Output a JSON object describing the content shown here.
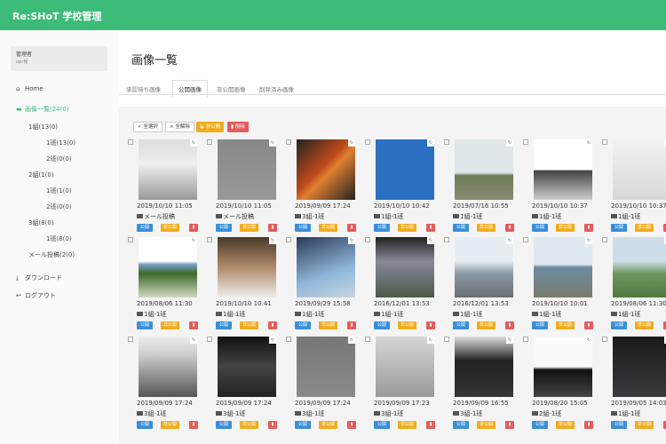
{
  "header": {
    "brand": "Re:SHoT 学校管理"
  },
  "user": {
    "role": "管理者",
    "name": "upr様"
  },
  "sidebar": {
    "home": "Home",
    "image_list": "画像一覧(24(0)",
    "class_1": "1組(13(0)",
    "class_1_group_1": "1班(13(0)",
    "class_1_group_2": "2班(0(0)",
    "class_2": "2組(1(0)",
    "class_2_group_1": "1班(1(0)",
    "class_2_group_2": "2班(0(0)",
    "class_3": "3組(8(0)",
    "class_3_group_1": "1班(8(0)",
    "mail_post": "メール投稿(2(0)",
    "download": "ダウンロード",
    "logout": "ログアウト"
  },
  "main": {
    "title": "画像一覧",
    "tabs": [
      "承認待ち画像",
      "公開画像",
      "非公開画像",
      "削除済み画像"
    ],
    "toolbar": {
      "select_all": "全選択",
      "deselect_all": "全解除",
      "private": "非公開",
      "delete": "削除"
    },
    "card_buttons": {
      "public": "公開",
      "private": "非公開"
    },
    "rows": [
      [
        {
          "date": "2019/10/10 11:05",
          "folder": "メール投稿"
        },
        {
          "date": "2019/10/10 11:05",
          "folder": "メール投稿"
        },
        {
          "date": "2019/09/09 17:24",
          "folder": "3組-1班"
        },
        {
          "date": "2019/10/10 10:42",
          "folder": "1組-1班"
        },
        {
          "date": "2019/07/16 10:55",
          "folder": "1組-1班"
        },
        {
          "date": "2019/10/10 10:37",
          "folder": "1組-1班"
        },
        {
          "date": "2019/10/10 10:37",
          "folder": "1組-1班"
        }
      ],
      [
        {
          "date": "2019/08/06 11:30",
          "folder": "1組-1班"
        },
        {
          "date": "2019/10/10 10:41",
          "folder": "1組-1班"
        },
        {
          "date": "2019/09/29 15:58",
          "folder": "1組-1班"
        },
        {
          "date": "2016/12/01 13:53",
          "folder": "1組-1班"
        },
        {
          "date": "2016/12/01 13:53",
          "folder": "1組-1班"
        },
        {
          "date": "2019/10/10 10:01",
          "folder": "1組-1班"
        },
        {
          "date": "2019/08/06 11:30",
          "folder": "1組-1班"
        }
      ],
      [
        {
          "date": "2019/09/09 17:24",
          "folder": "3組-1班"
        },
        {
          "date": "2019/09/09 17:24",
          "folder": "3組-1班"
        },
        {
          "date": "2019/09/09 17:24",
          "folder": "3組-1班"
        },
        {
          "date": "2019/09/09 17:23",
          "folder": "3組-1班"
        },
        {
          "date": "2019/09/09 16:55",
          "folder": "3組-1班"
        },
        {
          "date": "2019/08/20 15:05",
          "folder": "2組-1班"
        },
        {
          "date": "2019/09/05 14:03",
          "folder": "1組-1班"
        }
      ]
    ]
  },
  "colors": {
    "brand_green": "#3dbb78",
    "public_blue": "#3a8fd9",
    "private_yellow": "#f0ad1e",
    "delete_red": "#e55b5b"
  }
}
